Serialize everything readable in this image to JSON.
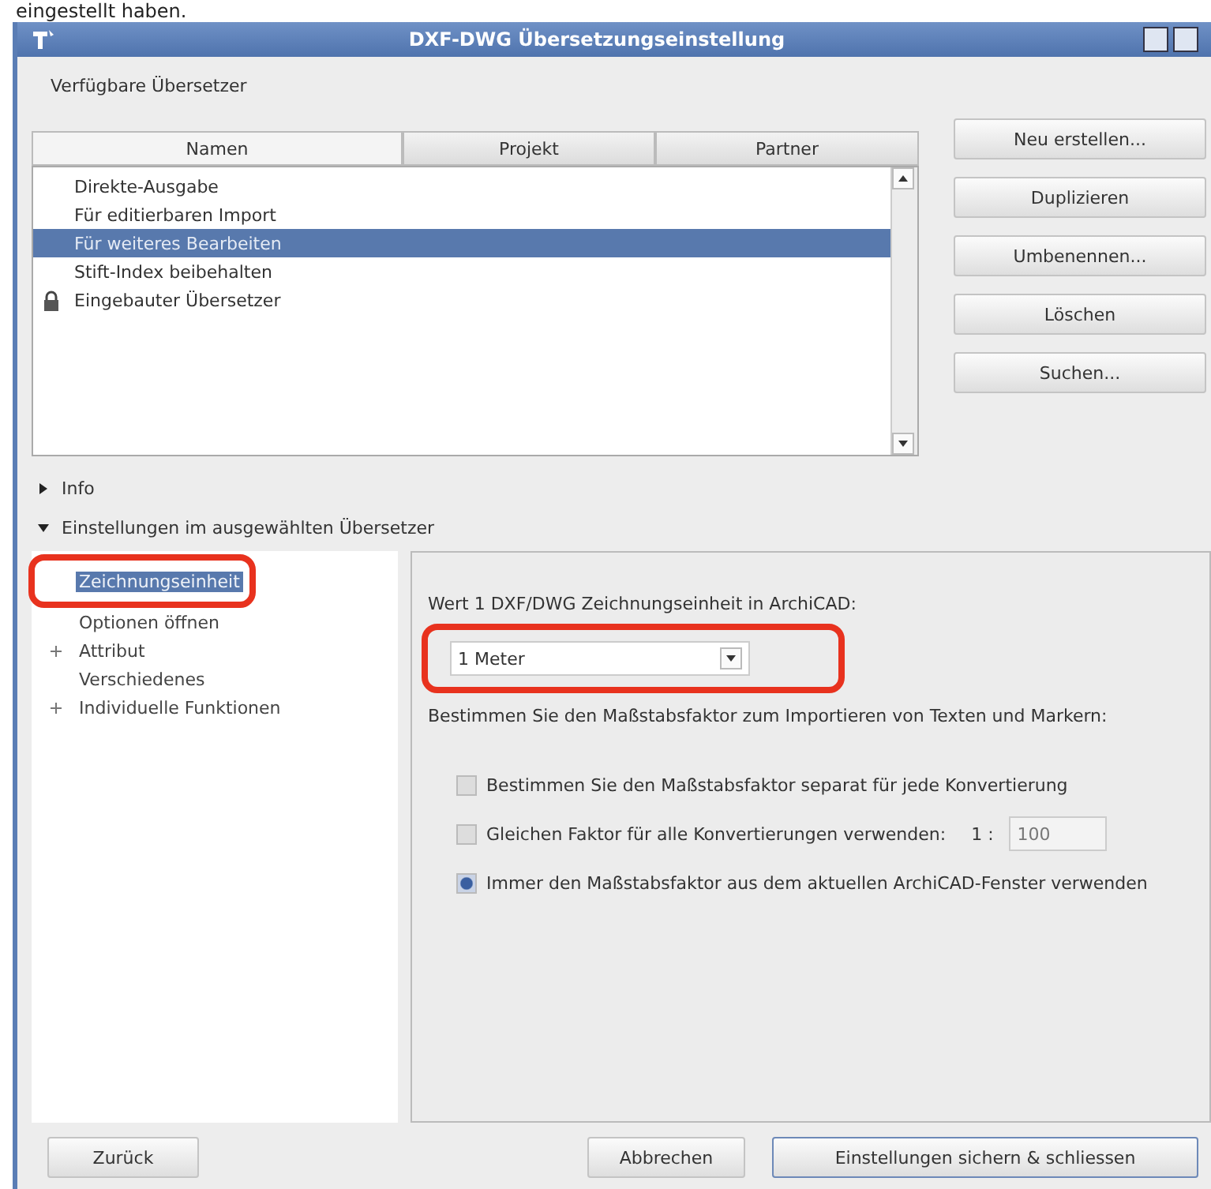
{
  "caption": "eingestellt haben.",
  "window": {
    "title": "DXF-DWG Übersetzungseinstellung"
  },
  "translators": {
    "label": "Verfügbare Übersetzer",
    "columns": [
      {
        "label": "Namen",
        "selected": true
      },
      {
        "label": "Projekt",
        "selected": false
      },
      {
        "label": "Partner",
        "selected": false
      }
    ],
    "items": [
      {
        "name": "Direkte-Ausgabe",
        "selected": false,
        "locked": false
      },
      {
        "name": "Für editierbaren Import",
        "selected": false,
        "locked": false
      },
      {
        "name": "Für weiteres Bearbeiten",
        "selected": true,
        "locked": false
      },
      {
        "name": "Stift-Index beibehalten",
        "selected": false,
        "locked": false
      },
      {
        "name": "Eingebauter Übersetzer",
        "selected": false,
        "locked": true
      }
    ]
  },
  "side_buttons": [
    "Neu erstellen...",
    "Duplizieren",
    "Umbenennen...",
    "Löschen",
    "Suchen..."
  ],
  "sections": [
    {
      "label": "Info",
      "expanded": false
    },
    {
      "label": "Einstellungen im ausgewählten Übersetzer",
      "expanded": true
    }
  ],
  "tree": [
    {
      "label": "Zeichnungseinheit",
      "selected": true,
      "expandable": false,
      "highlighted": true
    },
    {
      "label": "Optionen öffnen",
      "selected": false,
      "expandable": false,
      "highlighted": false
    },
    {
      "label": "Attribut",
      "selected": false,
      "expandable": true,
      "highlighted": false
    },
    {
      "label": "Verschiedenes",
      "selected": false,
      "expandable": false,
      "highlighted": false
    },
    {
      "label": "Individuelle Funktionen",
      "selected": false,
      "expandable": true,
      "highlighted": false
    }
  ],
  "settings": {
    "unit_label": "Wert 1 DXF/DWG Zeichnungseinheit in ArchiCAD:",
    "unit_value": "1 Meter",
    "unit_highlighted": true,
    "scale_label": "Bestimmen Sie den Maßstabsfaktor zum Importieren von Texten und Markern:",
    "options": [
      {
        "label": "Bestimmen Sie den Maßstabsfaktor separat für jede Konvertierung",
        "checked": false
      },
      {
        "label": "Gleichen Faktor für alle Konvertierungen verwenden:",
        "checked": false,
        "ratio_prefix": "1 :",
        "ratio_value": "100"
      },
      {
        "label": "Immer den Maßstabsfaktor aus dem aktuellen ArchiCAD-Fenster verwenden",
        "checked": true
      }
    ]
  },
  "footer": {
    "back": "Zurück",
    "cancel": "Abbrechen",
    "save": "Einstellungen sichern & schliessen"
  }
}
